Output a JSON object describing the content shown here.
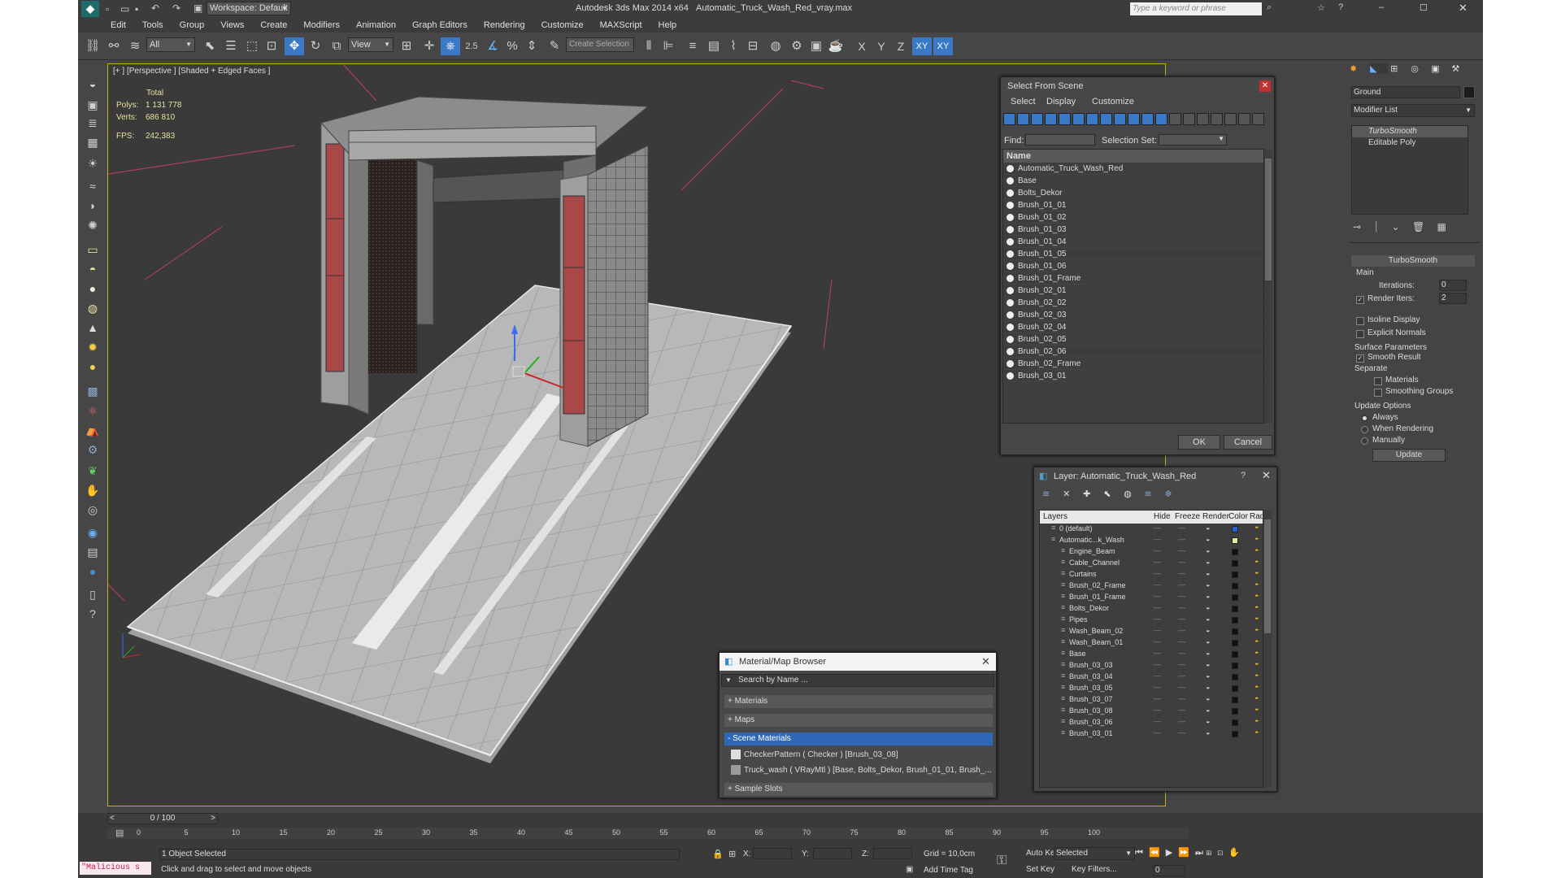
{
  "title": {
    "workspace": "Workspace: Default",
    "app": "Autodesk 3ds Max  2014 x64",
    "file": "Automatic_Truck_Wash_Red_vray.max",
    "search_placeholder": "Type a keyword or phrase"
  },
  "menu": [
    "Edit",
    "Tools",
    "Group",
    "Views",
    "Create",
    "Modifiers",
    "Animation",
    "Graph Editors",
    "Rendering",
    "Customize",
    "MAXScript",
    "Help"
  ],
  "toolbar": {
    "filter": "All",
    "ref_coord": "View",
    "snap_label": "2.5",
    "selection_set": "Create Selection Se",
    "axes": [
      "X",
      "Y",
      "Z",
      "XY",
      "XY"
    ]
  },
  "viewport": {
    "label": "[+ ] [Perspective ] [Shaded + Edged Faces ]",
    "stats": {
      "total": "Total",
      "polys_label": "Polys:",
      "polys": "1 131 778",
      "verts_label": "Verts:",
      "verts": "686 810",
      "fps_label": "FPS:",
      "fps": "242,383"
    }
  },
  "select_scene": {
    "title": "Select From Scene",
    "tabs": [
      "Select",
      "Display",
      "Customize"
    ],
    "find_label": "Find:",
    "selection_set_label": "Selection Set:",
    "column_name": "Name",
    "items": [
      "Automatic_Truck_Wash_Red",
      "Base",
      "Bolts_Dekor",
      "Brush_01_01",
      "Brush_01_02",
      "Brush_01_03",
      "Brush_01_04",
      "Brush_01_05",
      "Brush_01_06",
      "Brush_01_Frame",
      "Brush_02_01",
      "Brush_02_02",
      "Brush_02_03",
      "Brush_02_04",
      "Brush_02_05",
      "Brush_02_06",
      "Brush_02_Frame",
      "Brush_03_01"
    ],
    "ok": "OK",
    "cancel": "Cancel"
  },
  "layer": {
    "title": "Layer: Automatic_Truck_Wash_Red",
    "help": "?",
    "columns": [
      "Layers",
      "Hide",
      "Freeze",
      "Render",
      "Color",
      "Radiosity"
    ],
    "rows": [
      {
        "name": "0 (default)",
        "indent": 1,
        "color": "#2a5fd0"
      },
      {
        "name": "Automatic...k_Wash",
        "indent": 1,
        "color": "#e8e8a0"
      },
      {
        "name": "Engine_Beam",
        "indent": 2,
        "color": "#111111"
      },
      {
        "name": "Cable_Channel",
        "indent": 2,
        "color": "#111111"
      },
      {
        "name": "Curtains",
        "indent": 2,
        "color": "#111111"
      },
      {
        "name": "Brush_02_Frame",
        "indent": 2,
        "color": "#111111"
      },
      {
        "name": "Brush_01_Frame",
        "indent": 2,
        "color": "#111111"
      },
      {
        "name": "Bolts_Dekor",
        "indent": 2,
        "color": "#111111"
      },
      {
        "name": "Pipes",
        "indent": 2,
        "color": "#111111"
      },
      {
        "name": "Wash_Beam_02",
        "indent": 2,
        "color": "#111111"
      },
      {
        "name": "Wash_Beam_01",
        "indent": 2,
        "color": "#111111"
      },
      {
        "name": "Base",
        "indent": 2,
        "color": "#111111"
      },
      {
        "name": "Brush_03_03",
        "indent": 2,
        "color": "#111111"
      },
      {
        "name": "Brush_03_04",
        "indent": 2,
        "color": "#111111"
      },
      {
        "name": "Brush_03_05",
        "indent": 2,
        "color": "#111111"
      },
      {
        "name": "Brush_03_07",
        "indent": 2,
        "color": "#111111"
      },
      {
        "name": "Brush_03_08",
        "indent": 2,
        "color": "#111111"
      },
      {
        "name": "Brush_03_06",
        "indent": 2,
        "color": "#111111"
      },
      {
        "name": "Brush_03_01",
        "indent": 2,
        "color": "#111111"
      }
    ]
  },
  "material_browser": {
    "title": "Material/Map Browser",
    "search": "Search by Name ...",
    "sections": [
      "+ Materials",
      "+ Maps",
      "- Scene Materials"
    ],
    "materials": [
      "CheckerPattern  ( Checker ) [Brush_03_08]",
      "Truck_wash  ( VRayMtl ) [Base, Bolts_Dekor, Brush_01_01, Brush_..."
    ],
    "sample_slots": "+ Sample Slots"
  },
  "command_panel": {
    "object_name": "Ground",
    "modifier_list": "Modifier List",
    "stack": [
      "TurboSmooth",
      "Editable Poly"
    ],
    "rollout_title": "TurboSmooth",
    "main_label": "Main",
    "iterations_label": "Iterations:",
    "iterations": "0",
    "render_iters_label": "Render Iters:",
    "render_iters": "2",
    "isoline": "Isoline Display",
    "explicit_normals": "Explicit Normals",
    "surface_params": "Surface Parameters",
    "smooth_result": "Smooth Result",
    "separate": "Separate",
    "materials": "Materials",
    "smoothing_groups": "Smoothing Groups",
    "update_options": "Update Options",
    "always": "Always",
    "when_rendering": "When Rendering",
    "manually": "Manually",
    "update_btn": "Update"
  },
  "timeline": {
    "frame": "0 / 100",
    "ticks": [
      "0",
      "5",
      "10",
      "15",
      "20",
      "25",
      "30",
      "35",
      "40",
      "45",
      "50",
      "55",
      "60",
      "65",
      "70",
      "75",
      "80",
      "85",
      "90",
      "95",
      "100"
    ]
  },
  "status": {
    "maxscript": "\"Malicious s",
    "selected": "1 Object Selected",
    "prompt": "Click and drag to select and move objects",
    "x_label": "X:",
    "y_label": "Y:",
    "z_label": "Z:",
    "grid": "Grid = 10,0cm",
    "add_time_tag": "Add Time Tag",
    "auto_key": "Auto Key",
    "set_key": "Set Key",
    "selected_dd": "Selected",
    "key_filters": "Key Filters...",
    "frame_field": "0"
  }
}
